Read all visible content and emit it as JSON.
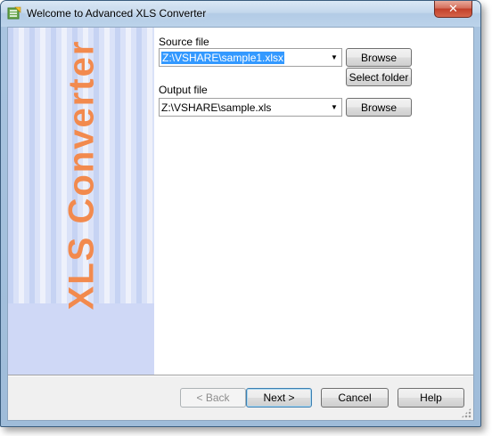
{
  "window": {
    "title": "Welcome to Advanced XLS Converter",
    "close_glyph": "✕"
  },
  "side_panel": {
    "title": "XLS Converter",
    "title_color": "#f28a4e"
  },
  "source": {
    "label": "Source file",
    "value": "Z:\\VSHARE\\sample1.xlsx",
    "browse_label": "Browse",
    "select_folder_label": "Select folder"
  },
  "output": {
    "label": "Output file",
    "value": "Z:\\VSHARE\\sample.xls",
    "browse_label": "Browse"
  },
  "footer": {
    "back_label": "< Back",
    "next_label": "Next >",
    "cancel_label": "Cancel",
    "help_label": "Help"
  }
}
